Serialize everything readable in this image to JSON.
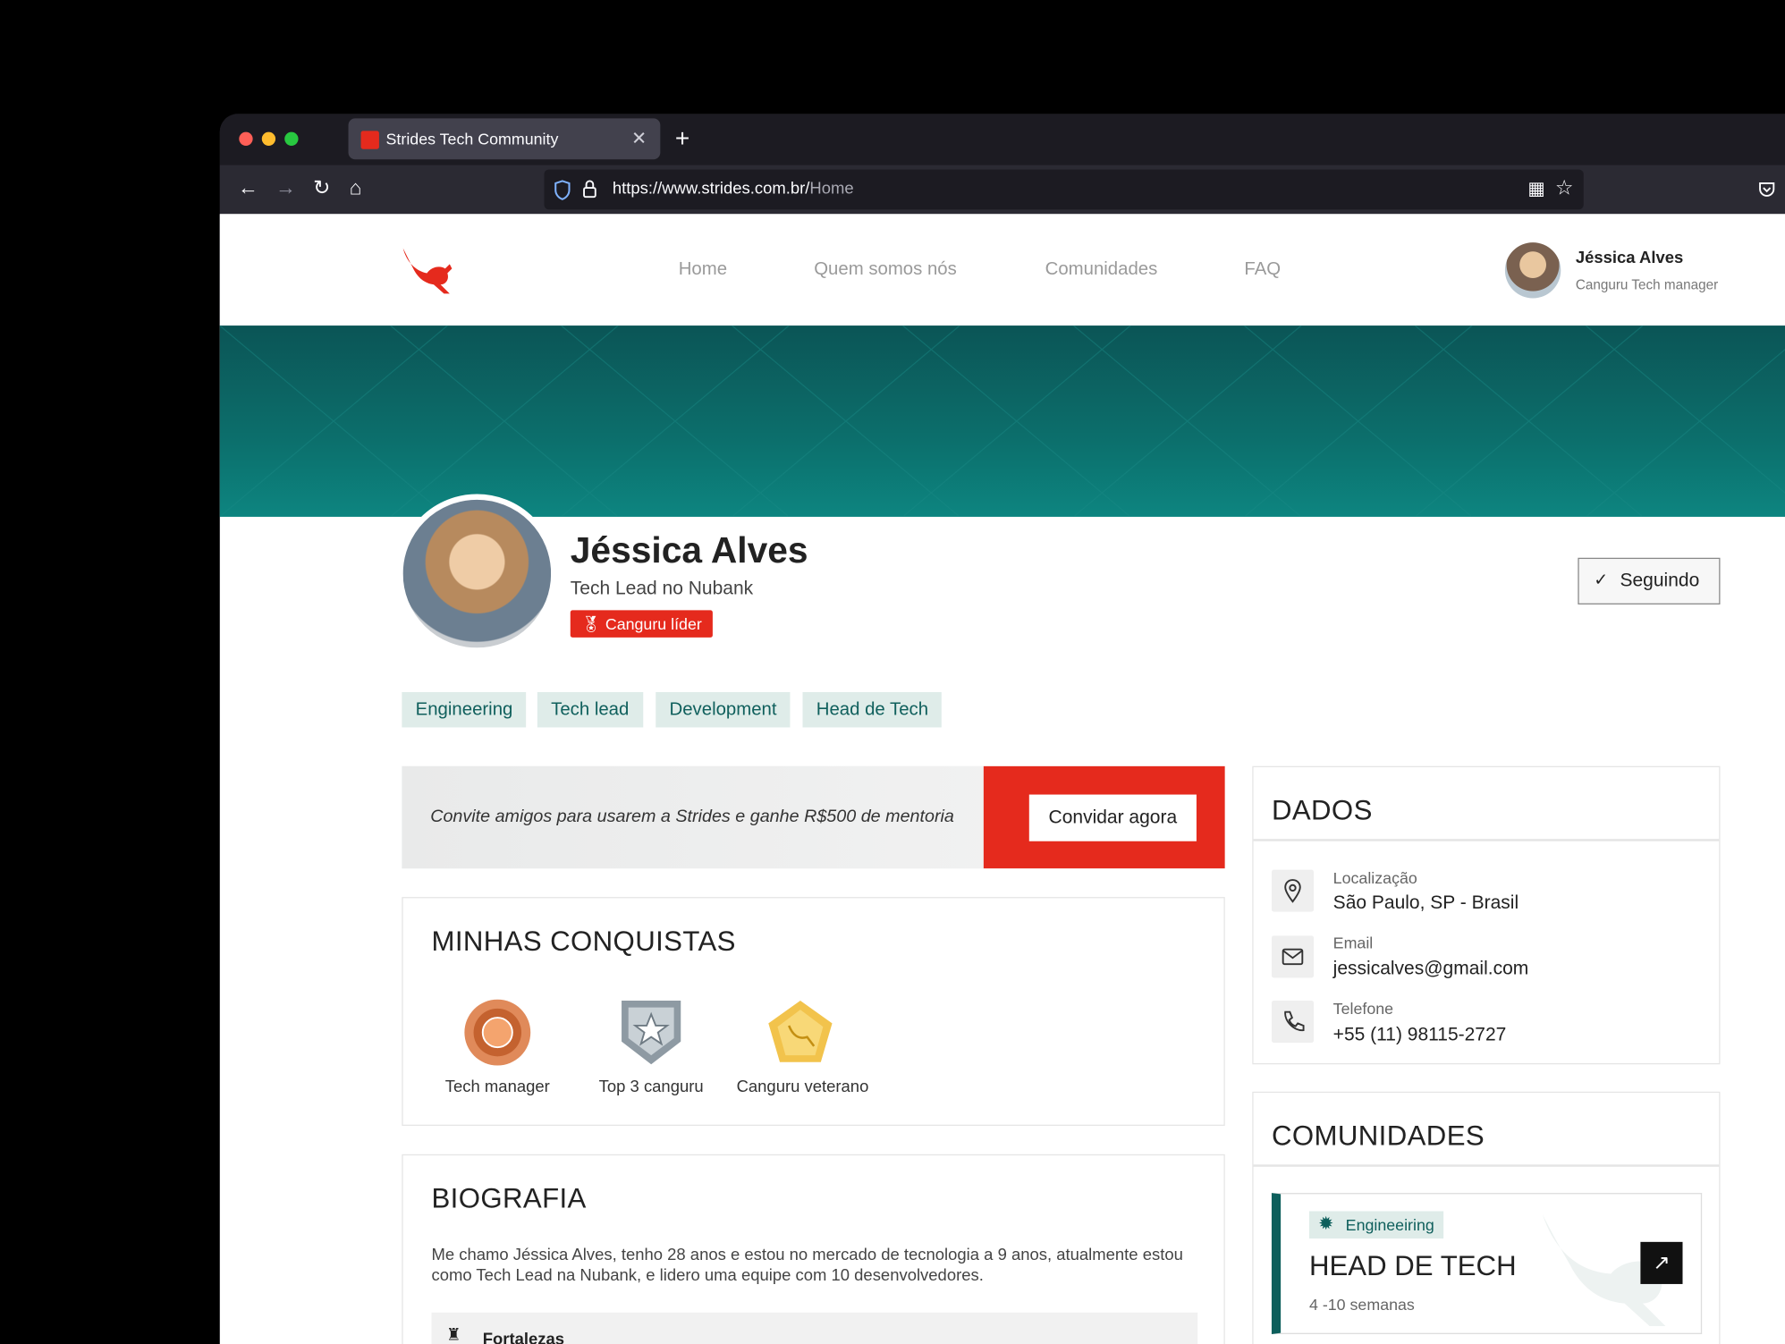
{
  "browser": {
    "tab_title": "Strides Tech Community",
    "url_base": "https://www.strides.com.br/",
    "url_path": "Home"
  },
  "nav": {
    "items": [
      "Home",
      "Quem somos nós",
      "Comunidades",
      "FAQ"
    ]
  },
  "user": {
    "name": "Jéssica Alves",
    "role": "Canguru Tech manager"
  },
  "profile": {
    "name": "Jéssica Alves",
    "title": "Tech Lead no Nubank",
    "badge": "Canguru líder",
    "follow_label": "Seguindo",
    "tags": [
      "Engineering",
      "Tech lead",
      "Development",
      "Head de Tech"
    ]
  },
  "invite": {
    "text": "Convite amigos para usarem a Strides e ganhe R$500 de mentoria",
    "button": "Convidar agora"
  },
  "achievements": {
    "title": "MINHAS CONQUISTAS",
    "items": [
      {
        "label": "Tech manager",
        "icon": "bronze-medal-icon"
      },
      {
        "label": "Top 3 canguru",
        "icon": "silver-shield-star-icon"
      },
      {
        "label": "Canguru veterano",
        "icon": "gold-pentagon-kangaroo-icon"
      }
    ]
  },
  "bio": {
    "title": "BIOGRAFIA",
    "text": "Me chamo Jéssica Alves, tenho 28 anos e estou no mercado de tecnologia a 9 anos, atualmente estou como Tech Lead na Nubank, e lidero uma equipe com 10 desenvolvedores.",
    "strengths_label": "Fortalezas"
  },
  "dados": {
    "title": "DADOS",
    "rows": [
      {
        "label": "Localização",
        "value": "São Paulo, SP - Brasil",
        "icon": "location-pin-icon"
      },
      {
        "label": "Email",
        "value": "jessicalves@gmail.com",
        "icon": "mail-icon"
      },
      {
        "label": "Telefone",
        "value": "+55 (11) 98115-2727",
        "icon": "phone-icon"
      }
    ]
  },
  "comunidades": {
    "title": "COMUNIDADES",
    "card": {
      "chip": "Engineeiring",
      "title": "HEAD DE TECH",
      "duration": "4 -10 semanas"
    }
  },
  "colors": {
    "brand_red": "#e52a1d",
    "teal": "#0d5f5c"
  }
}
